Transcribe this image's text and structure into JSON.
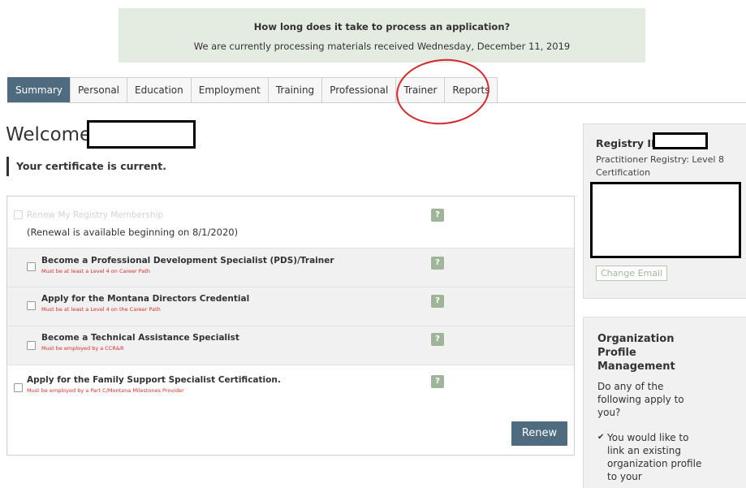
{
  "notice": {
    "question": "How long does it take to process an application?",
    "processing": "We are currently processing materials received Wednesday, December 11, 2019"
  },
  "tabs": [
    {
      "label": "Summary",
      "active": true
    },
    {
      "label": "Personal"
    },
    {
      "label": "Education"
    },
    {
      "label": "Employment"
    },
    {
      "label": "Training"
    },
    {
      "label": "Professional"
    },
    {
      "label": "Trainer"
    },
    {
      "label": "Reports"
    }
  ],
  "welcome": "Welcome,",
  "status": "Your certificate is current.",
  "membership": {
    "renew_label": "Renew My Registry Membership",
    "renewal_note": "(Renewal is available beginning on 8/1/2020)",
    "options": [
      {
        "label": "Become a Professional Development Specialist (PDS)/Trainer",
        "requirement": "Must be at least a Level 4 on Career Path"
      },
      {
        "label": "Apply for the Montana Directors Credential",
        "requirement": "Must be at least a Level 4 on the Career Path"
      },
      {
        "label": "Become a Technical Assistance Specialist",
        "requirement": "Must be employed by a CCR&R"
      },
      {
        "label": "Apply for the Family Support Specialist Certification.",
        "requirement": "Must be employed by a Part C/Montana Milestones Provider"
      }
    ],
    "help_icon": "?",
    "renew_button": "Renew"
  },
  "registry": {
    "id_label": "Registry ID",
    "level": "Practitioner Registry: Level 8 Certification",
    "change_email": "Change Email"
  },
  "org": {
    "title": "Organization Profile Management",
    "question": "Do any of the following apply to you?",
    "check_icon": "✔",
    "item": "You would like to link an existing organization profile to your"
  },
  "colors": {
    "accent": "#4f6b7f",
    "help": "#9fb59a",
    "requirement": "#d9302c",
    "annotation": "#d7262c"
  }
}
